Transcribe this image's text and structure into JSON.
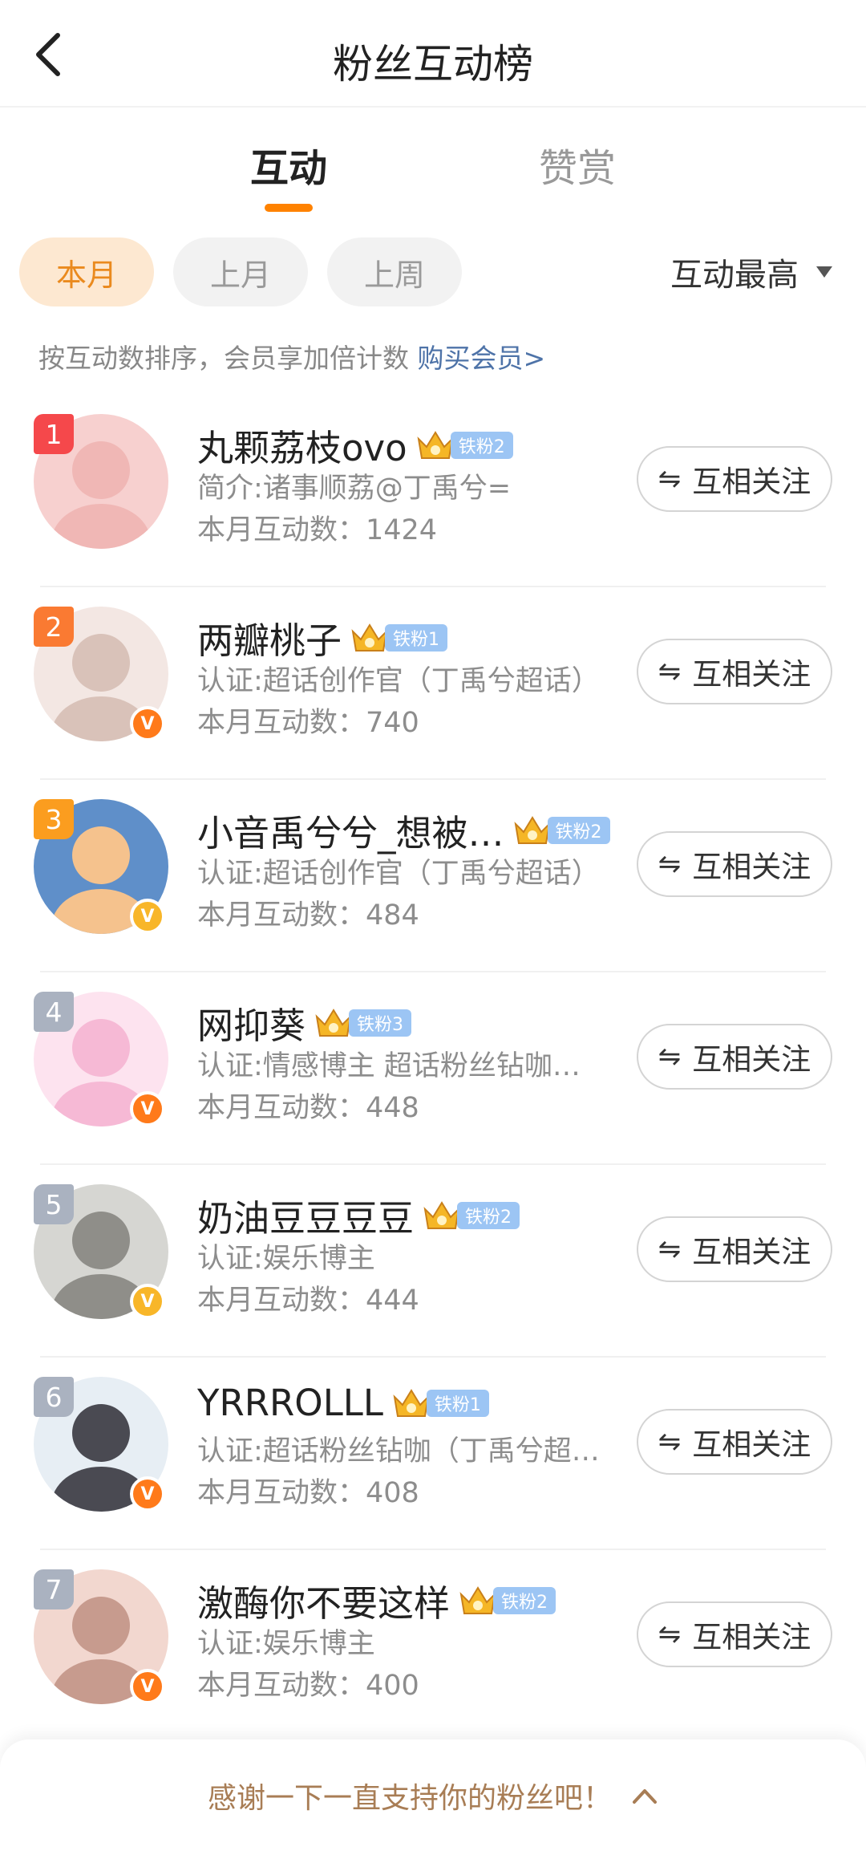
{
  "nav": {
    "title": "粉丝互动榜",
    "back_icon": "chevron-left-icon"
  },
  "tabs": [
    {
      "label": "互动",
      "active": true
    },
    {
      "label": "赞赏",
      "active": false
    }
  ],
  "filters": {
    "periods": [
      {
        "label": "本月",
        "active": true
      },
      {
        "label": "上月",
        "active": false
      },
      {
        "label": "上周",
        "active": false
      }
    ],
    "sort_label": "互动最高"
  },
  "hint": {
    "text": "按互动数排序，会员享加倍计数",
    "link": "购买会员>"
  },
  "colors": {
    "accent": "#ff8200",
    "link": "#4e73a8",
    "fan_badge": "#9cc5f4",
    "rank_1": "#f5484b",
    "rank_2": "#fa7a32",
    "rank_3": "#fb9d1f",
    "rank_other": "#aab2c0",
    "verify_orange": "#ff7a1a",
    "verify_gold": "#f8b629"
  },
  "fans": [
    {
      "rank": "1",
      "name": "丸颗荔枝ovo",
      "fan_level": "铁粉2",
      "desc": "简介:诸事顺荔@丁禹兮=",
      "count": "本月互动数：1424",
      "verified": false,
      "follow_label": "互相关注"
    },
    {
      "rank": "2",
      "name": "两瓣桃子",
      "fan_level": "铁粉1",
      "desc": "认证:超话创作官（丁禹兮超话）",
      "count": "本月互动数：740",
      "verified": "orange",
      "follow_label": "互相关注"
    },
    {
      "rank": "3",
      "name": "小音禹兮兮_想被…",
      "fan_level": "铁粉2",
      "desc": "认证:超话创作官（丁禹兮超话）",
      "count": "本月互动数：484",
      "verified": "gold",
      "follow_label": "互相关注"
    },
    {
      "rank": "4",
      "name": "网抑葵",
      "fan_level": "铁粉3",
      "desc": "认证:情感博主 超话粉丝钻咖…",
      "count": "本月互动数：448",
      "verified": "orange",
      "follow_label": "互相关注"
    },
    {
      "rank": "5",
      "name": "奶油豆豆豆豆",
      "fan_level": "铁粉2",
      "desc": "认证:娱乐博主",
      "count": "本月互动数：444",
      "verified": "gold",
      "follow_label": "互相关注"
    },
    {
      "rank": "6",
      "name": "YRRROLLL",
      "fan_level": "铁粉1",
      "desc": "认证:超话粉丝钻咖（丁禹兮超…",
      "count": "本月互动数：408",
      "verified": "orange",
      "follow_label": "互相关注"
    },
    {
      "rank": "7",
      "name": "激酶你不要这样",
      "fan_level": "铁粉2",
      "desc": "认证:娱乐博主",
      "count": "本月互动数：400",
      "verified": "orange",
      "follow_label": "互相关注"
    }
  ],
  "bottom_bar": {
    "text": "感谢一下一直支持你的粉丝吧！",
    "icon": "chevron-up-icon"
  }
}
